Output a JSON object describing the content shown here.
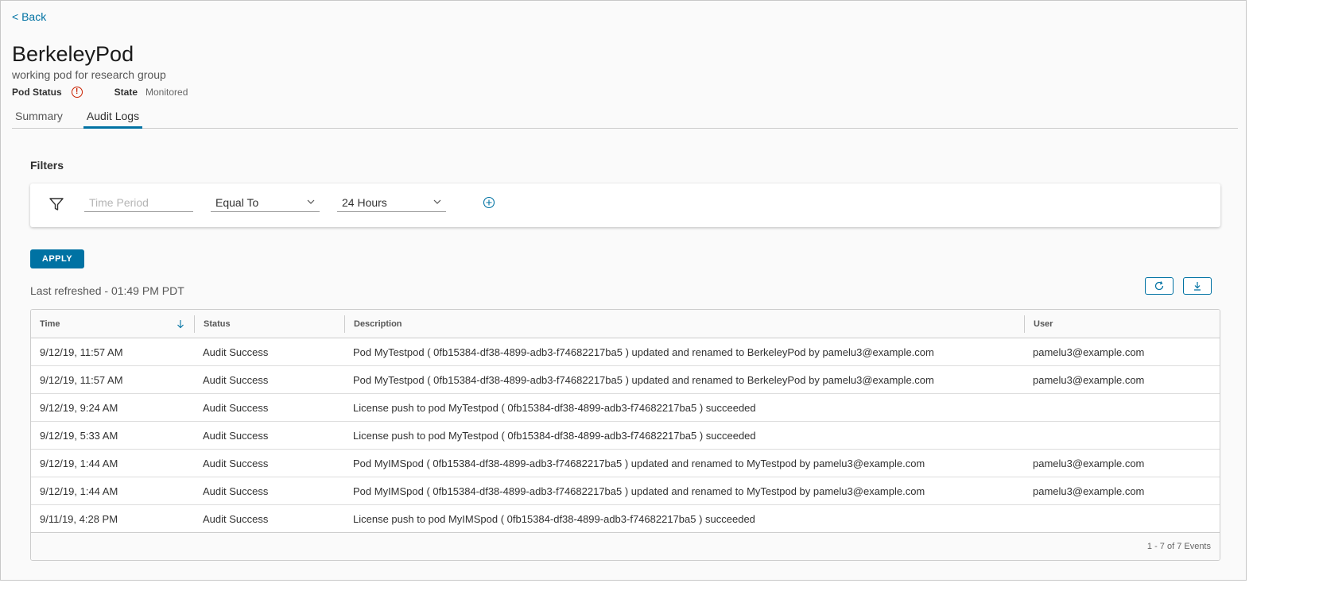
{
  "nav": {
    "back_label": "< Back"
  },
  "pod": {
    "title": "BerkeleyPod",
    "subtitle": "working pod for research group",
    "status_label": "Pod Status",
    "state_label": "State",
    "state_value": "Monitored"
  },
  "tabs": [
    {
      "label": "Summary",
      "active": false
    },
    {
      "label": "Audit Logs",
      "active": true
    }
  ],
  "filters": {
    "heading": "Filters",
    "time_period_placeholder": "Time Period",
    "operator_value": "Equal To",
    "period_value": "24 Hours",
    "apply_label": "APPLY"
  },
  "last_refreshed": "Last refreshed - 01:49 PM PDT",
  "table": {
    "columns": [
      "Time",
      "Status",
      "Description",
      "User"
    ],
    "rows": [
      [
        "9/12/19, 11:57 AM",
        "Audit Success",
        "Pod MyTestpod ( 0fb15384-df38-4899-adb3-f74682217ba5 ) updated and renamed to BerkeleyPod by pamelu3@example.com",
        "pamelu3@example.com"
      ],
      [
        "9/12/19, 11:57 AM",
        "Audit Success",
        "Pod MyTestpod ( 0fb15384-df38-4899-adb3-f74682217ba5 ) updated and renamed to BerkeleyPod by pamelu3@example.com",
        "pamelu3@example.com"
      ],
      [
        "9/12/19, 9:24 AM",
        "Audit Success",
        "License push to pod MyTestpod ( 0fb15384-df38-4899-adb3-f74682217ba5 ) succeeded",
        ""
      ],
      [
        "9/12/19, 5:33 AM",
        "Audit Success",
        "License push to pod MyTestpod ( 0fb15384-df38-4899-adb3-f74682217ba5 ) succeeded",
        ""
      ],
      [
        "9/12/19, 1:44 AM",
        "Audit Success",
        "Pod MyIMSpod ( 0fb15384-df38-4899-adb3-f74682217ba5 ) updated and renamed to MyTestpod by pamelu3@example.com",
        "pamelu3@example.com"
      ],
      [
        "9/12/19, 1:44 AM",
        "Audit Success",
        "Pod MyIMSpod ( 0fb15384-df38-4899-adb3-f74682217ba5 ) updated and renamed to MyTestpod by pamelu3@example.com",
        "pamelu3@example.com"
      ],
      [
        "9/11/19, 4:28 PM",
        "Audit Success",
        "License push to pod MyIMSpod ( 0fb15384-df38-4899-adb3-f74682217ba5 ) succeeded",
        ""
      ]
    ],
    "footer": "1 - 7 of 7 Events"
  },
  "icons": {
    "status": "error-circle-icon",
    "filter": "funnel-icon",
    "add": "plus-circle-icon",
    "refresh": "refresh-icon",
    "download": "download-icon",
    "sort": "arrow-down-icon"
  },
  "colors": {
    "accent": "#0072a3",
    "error": "#c92100"
  }
}
